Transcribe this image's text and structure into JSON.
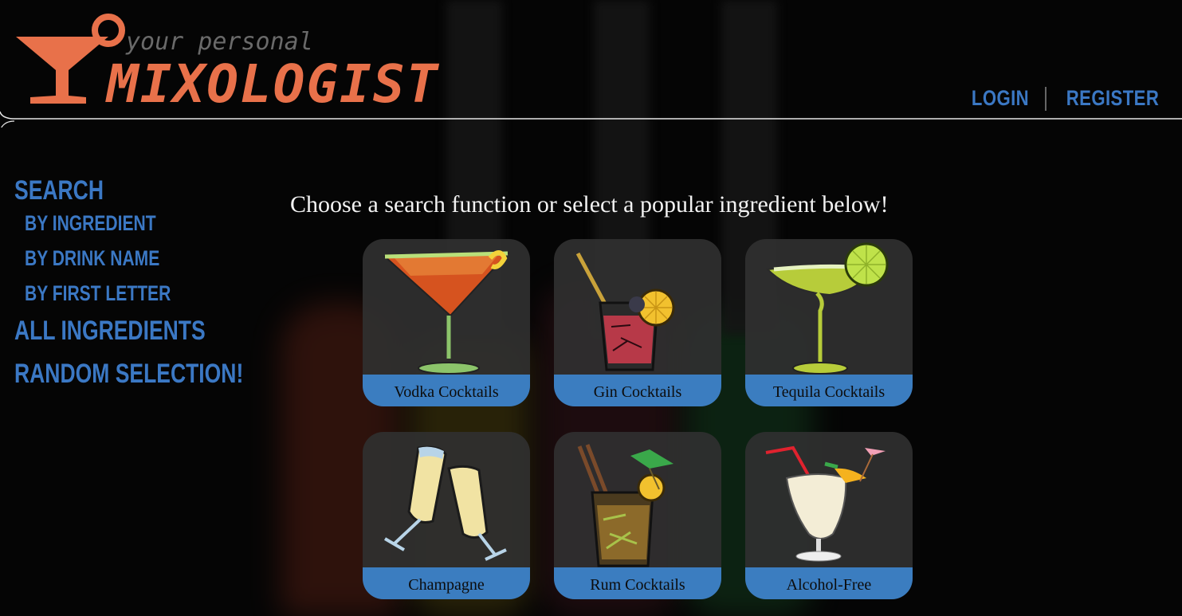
{
  "brand": {
    "tagline": "your personal",
    "name": "MIXOLOGIST",
    "accent_color": "#e8714a"
  },
  "auth": {
    "login_label": "LOGIN",
    "register_label": "REGISTER"
  },
  "sidebar": {
    "search_label": "SEARCH",
    "by_ingredient_label": "BY INGREDIENT",
    "by_drink_name_label": "BY DRINK NAME",
    "by_first_letter_label": "BY FIRST LETTER",
    "all_ingredients_label": "ALL INGREDIENTS",
    "random_label": "RANDOM SELECTION!"
  },
  "main": {
    "prompt": "Choose a search function or select a popular ingredient below!",
    "cards": [
      {
        "label": "Vodka Cocktails",
        "icon": "martini-glass-icon"
      },
      {
        "label": "Gin Cocktails",
        "icon": "highball-glass-icon"
      },
      {
        "label": "Tequila Cocktails",
        "icon": "margarita-glass-icon"
      },
      {
        "label": "Champagne",
        "icon": "champagne-toast-icon"
      },
      {
        "label": "Rum Cocktails",
        "icon": "mojito-glass-icon"
      },
      {
        "label": "Alcohol-Free",
        "icon": "pina-colada-icon"
      }
    ]
  },
  "colors": {
    "link_blue": "#3b78c4",
    "label_bar": "#3b7dc0",
    "card_bg": "#303030"
  }
}
